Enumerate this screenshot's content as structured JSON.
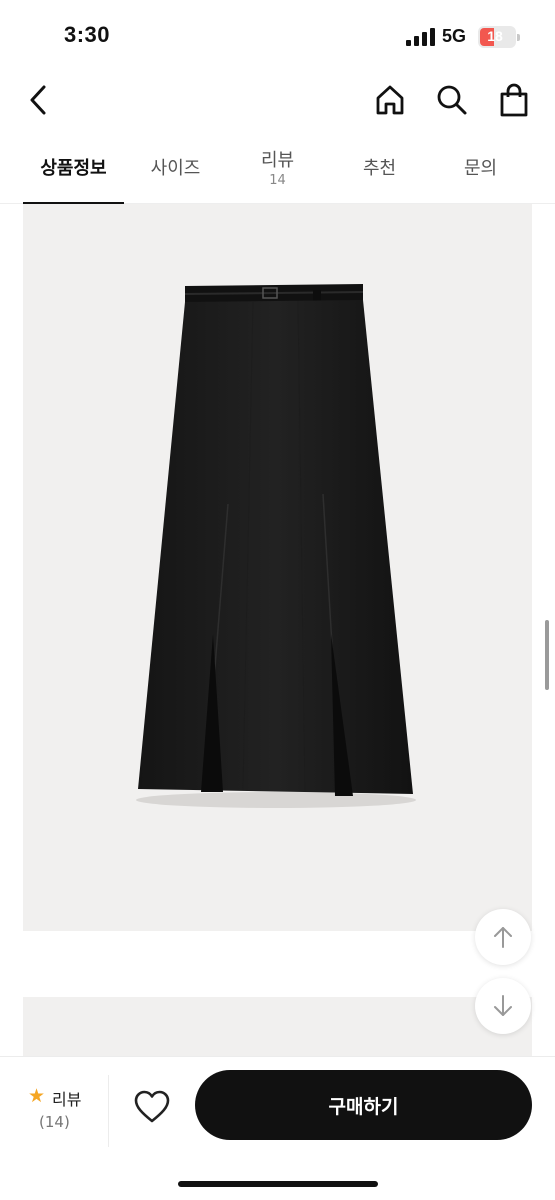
{
  "status_bar": {
    "time": "3:30",
    "network": "5G",
    "battery_level": "18",
    "battery_color": "#f2574f"
  },
  "nav": {
    "back_icon": "chevron-left-icon",
    "home_icon": "home-icon",
    "search_icon": "search-icon",
    "cart_icon": "shopping-bag-icon"
  },
  "tabs": [
    {
      "label": "상품정보",
      "active": true
    },
    {
      "label": "사이즈"
    },
    {
      "label": "리뷰",
      "count": "14"
    },
    {
      "label": "추천"
    },
    {
      "label": "문의"
    }
  ],
  "content": {
    "product_image": "black pleated maxi skirt with belt",
    "scroll_up_icon": "arrow-up-icon",
    "scroll_down_icon": "arrow-down-icon"
  },
  "bottom_bar": {
    "review_label": "리뷰",
    "review_count": "(14)",
    "star_color": "#f5a623",
    "wishlist_icon": "heart-icon",
    "buy_label": "구매하기",
    "buy_color": "#111111"
  }
}
